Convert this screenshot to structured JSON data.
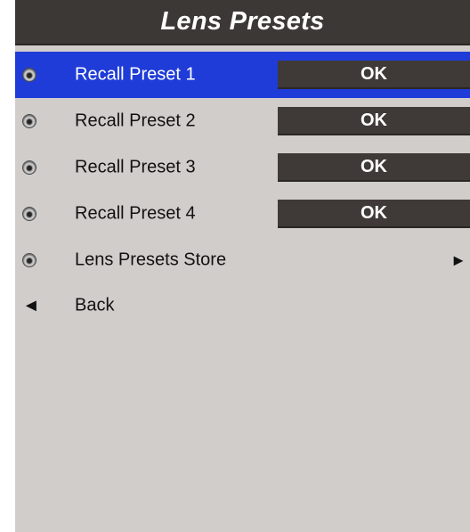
{
  "menu": {
    "title": "Lens Presets",
    "items": [
      {
        "label": "Recall Preset 1",
        "value": "OK",
        "icon": "bullet-icon",
        "selected": true
      },
      {
        "label": "Recall Preset 2",
        "value": "OK",
        "icon": "bullet-icon",
        "selected": false
      },
      {
        "label": "Recall Preset 3",
        "value": "OK",
        "icon": "bullet-icon",
        "selected": false
      },
      {
        "label": "Recall Preset 4",
        "value": "OK",
        "icon": "bullet-icon",
        "selected": false
      },
      {
        "label": "Lens Presets Store",
        "submenu_glyph": "►",
        "icon": "bullet-icon",
        "selected": false
      },
      {
        "label": "Back",
        "back_glyph": "◄",
        "icon": "back-arrow-icon",
        "selected": false
      }
    ]
  },
  "colors": {
    "panel_background": "#d1cdcb",
    "header_background": "#3c3835",
    "selected_row": "#1f3cd8",
    "button_background": "#3f3a37"
  }
}
